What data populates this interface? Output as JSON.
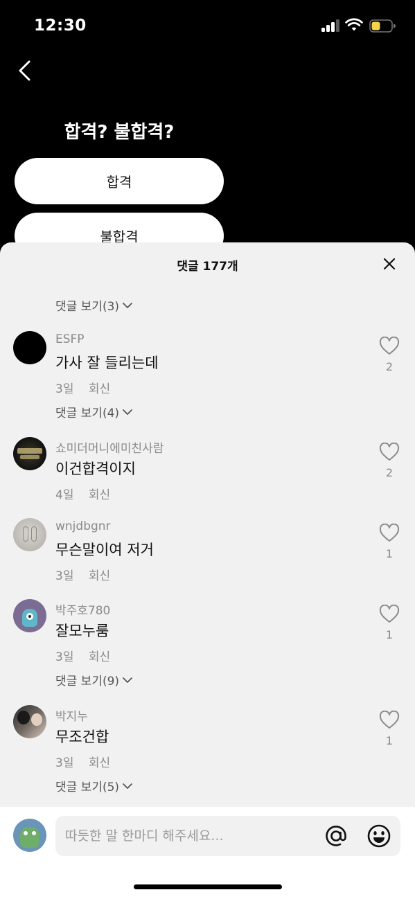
{
  "status_bar": {
    "time": "12:30"
  },
  "quiz": {
    "title": "합격? 불합격?",
    "options": [
      "합격",
      "불합격"
    ]
  },
  "comments_sheet": {
    "title": "댓글 177개",
    "top_replies_label": "댓글 보기(3)",
    "comments": [
      {
        "username": "ESFP",
        "text": "가사 잘 들리는데",
        "age": "3일",
        "reply_label": "회신",
        "likes": "2",
        "replies_label": "댓글 보기(4)"
      },
      {
        "username": "쇼미더머니에미친사람",
        "text": "이건합격이지",
        "age": "4일",
        "reply_label": "회신",
        "likes": "2",
        "replies_label": ""
      },
      {
        "username": "wnjdbgnr",
        "text": "무슨말이여 저거",
        "age": "3일",
        "reply_label": "회신",
        "likes": "1",
        "replies_label": ""
      },
      {
        "username": "박주호780",
        "text": "잘모누룸",
        "age": "3일",
        "reply_label": "회신",
        "likes": "1",
        "replies_label": "댓글 보기(9)"
      },
      {
        "username": "박지누",
        "text": "무조건합",
        "age": "3일",
        "reply_label": "회신",
        "likes": "1",
        "replies_label": "댓글 보기(5)"
      }
    ]
  },
  "composer": {
    "placeholder": "따듯한 말 한마디 해주세요..."
  },
  "colors": {
    "background": "#000000",
    "sheet": "#f1f1f2",
    "battery": "#f5d547"
  }
}
